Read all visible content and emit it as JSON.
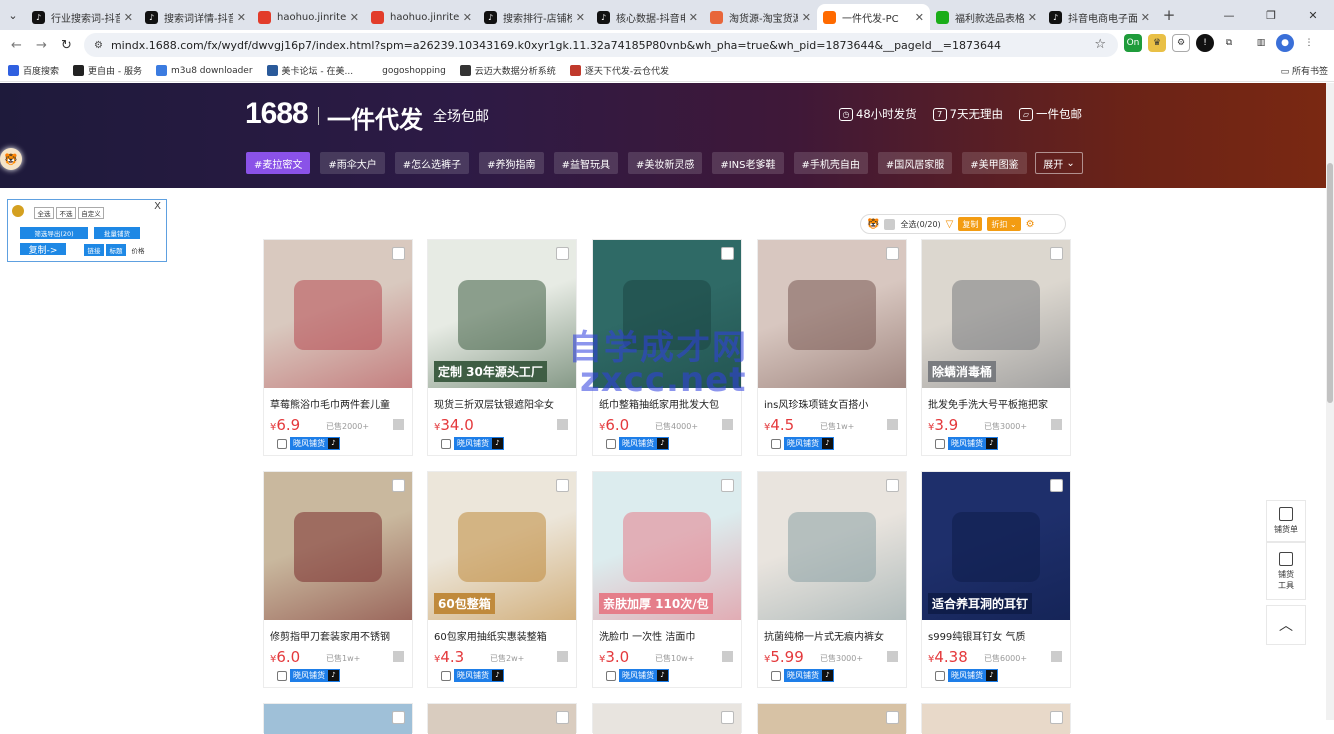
{
  "browser": {
    "tabs": [
      {
        "label": "行业搜索词-抖音电商",
        "color": "#111",
        "icon": "tiktok-icon"
      },
      {
        "label": "搜索词详情-抖音电商",
        "color": "#111",
        "icon": "tiktok-icon"
      },
      {
        "label": "haohuo.jinritemai.com",
        "color": "#e23c2a",
        "icon": "haohuo-icon"
      },
      {
        "label": "haohuo.jinritemai.com",
        "color": "#e23c2a",
        "icon": "haohuo-icon"
      },
      {
        "label": "搜索排行-店铺榜单",
        "color": "#111",
        "icon": "tiktok-icon"
      },
      {
        "label": "核心数据-抖音电商",
        "color": "#111",
        "icon": "tiktok-icon"
      },
      {
        "label": "淘货源-淘宝货源",
        "color": "#e8663a",
        "icon": "taohuo-icon"
      },
      {
        "label": "一件代发-PC",
        "color": "#ff6a00",
        "icon": "1688-icon",
        "active": true
      },
      {
        "label": "福利款选品表格",
        "color": "#1aad19",
        "icon": "sheet-icon"
      },
      {
        "label": "抖音电商电子面单",
        "color": "#111",
        "icon": "tiktok-icon"
      }
    ],
    "url": "mindx.1688.com/fx/wydf/dwvgj16p7/index.html?spm=a26239.10343169.k0xyr1gk.11.32a74185P80vnb&wh_pha=true&wh_pid=1873644&__pageId__=1873644",
    "bookmarks": [
      {
        "label": "百度搜索",
        "color": "#3060e0"
      },
      {
        "label": "更自由 - 服务",
        "color": "#222"
      },
      {
        "label": "m3u8 downloader",
        "color": "#3b7be0"
      },
      {
        "label": "美卡论坛 - 在美...",
        "color": "#2a5a9a"
      },
      {
        "label": "gogoshopping",
        "color": "#ffffff"
      },
      {
        "label": "云迈大数据分析系统",
        "color": "#333"
      },
      {
        "label": "逐天下代发-云仓代发",
        "color": "#c0392b"
      }
    ],
    "all_bookmarks": "所有书签"
  },
  "banner": {
    "logo": "1688",
    "title": "一件代发",
    "subtitle": "全场包邮",
    "perks": [
      "48小时发货",
      "7天无理由",
      "一件包邮"
    ],
    "tags": [
      "#麦拉密文",
      "#雨伞大户",
      "#怎么选裤子",
      "#养狗指南",
      "#益智玩具",
      "#美妆新灵感",
      "#INS老爹鞋",
      "#手机壳自由",
      "#国风居家服",
      "#美甲图鉴"
    ],
    "expand": "展开"
  },
  "helper": {
    "options": [
      "全选",
      "不选",
      "自定义"
    ],
    "export_btn": "筛选导出(20)",
    "batch_btn": "批量铺货",
    "copy_btn": "复制->",
    "fields": [
      "链接",
      "标题",
      "价格"
    ]
  },
  "toolbar": {
    "select_all": "全选(0/20)",
    "copy": "复制",
    "discount": "折扣"
  },
  "watermark": {
    "line1": "自学成才网",
    "line2": "zxcc.net"
  },
  "products": [
    {
      "title": "草莓熊浴巾毛巾两件套儿童",
      "price": "6.9",
      "sold": "已售2000+",
      "btn": "晓风铺货",
      "bg": "#d9c9bf",
      "tone": "#b64a52"
    },
    {
      "title": "现货三折双层钛银遮阳伞女",
      "price": "34.0",
      "sold": "",
      "btn": "晓风铺货",
      "bg": "#e7ebe4",
      "tone": "#3f5e44",
      "ov": "定制 30年源头工厂"
    },
    {
      "title": "纸巾整箱抽纸家用批发大包",
      "price": "6.0",
      "sold": "已售4000+",
      "btn": "晓风铺货",
      "bg": "#2f6a66",
      "tone": "#1b4644"
    },
    {
      "title": "ins风珍珠项链女百搭小",
      "price": "4.5",
      "sold": "已售1w+",
      "btn": "晓风铺货",
      "bg": "#d8c7c0",
      "tone": "#7a5a54"
    },
    {
      "title": "批发免手洗大号平板拖把家",
      "price": "3.9",
      "sold": "已售3000+",
      "btn": "晓风铺货",
      "bg": "#dcd7cf",
      "tone": "#7a7c80",
      "ov": "除螨消毒桶"
    },
    {
      "title": "修剪指甲刀套装家用不锈钢",
      "price": "6.0",
      "sold": "已售1w+",
      "btn": "晓风铺货",
      "bg": "#c9b89e",
      "tone": "#7a2d2d"
    },
    {
      "title": "60包家用抽纸实惠装整箱",
      "price": "4.3",
      "sold": "已售2w+",
      "btn": "晓风铺货",
      "bg": "#ece6da",
      "tone": "#c08a3c",
      "ov": "60包整箱"
    },
    {
      "title": "洗脸巾 一次性 洁面巾",
      "price": "3.0",
      "sold": "已售10w+",
      "btn": "晓风铺货",
      "bg": "#dcecee",
      "tone": "#e57e8a",
      "ov": "亲肤加厚 110次/包"
    },
    {
      "title": "抗菌纯棉一片式无痕内裤女",
      "price": "5.99",
      "sold": "已售3000+",
      "btn": "晓风铺货",
      "bg": "#e9e4de",
      "tone": "#8aa0a4"
    },
    {
      "title": "s999纯银耳钉女 气质",
      "price": "4.38",
      "sold": "已售6000+",
      "btn": "晓风铺货",
      "bg": "#1e2f6b",
      "tone": "#0f1d4a",
      "ov": "适合养耳洞的耳钉"
    }
  ],
  "side": [
    {
      "label": "铺货单"
    },
    {
      "label": "铺货工具"
    }
  ]
}
